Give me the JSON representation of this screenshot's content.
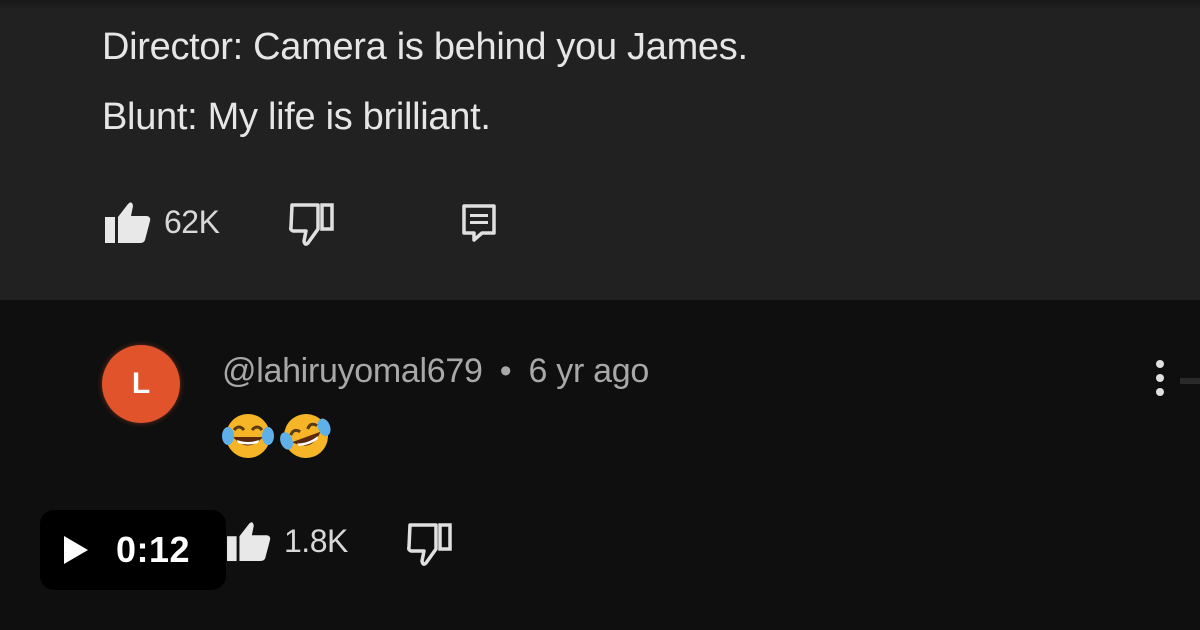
{
  "comment": {
    "lines": [
      "Director: Camera is behind you James.",
      "Blunt: My life is brilliant."
    ],
    "like_count": "62K",
    "icons": {
      "like": "thumbs-up-icon",
      "dislike": "thumbs-down-icon",
      "reply": "reply-icon"
    }
  },
  "reply": {
    "avatar_letter": "L",
    "avatar_color": "#e0532b",
    "handle": "@lahiruyomal679",
    "separator": "•",
    "time": "6 yr ago",
    "body_emojis": [
      "face-with-tears-of-joy",
      "rolling-on-floor-laughing"
    ],
    "like_count": "1.8K",
    "menu_icon": "more-vertical-icon"
  },
  "video_badge": {
    "duration": "0:12",
    "icon": "play-icon"
  }
}
